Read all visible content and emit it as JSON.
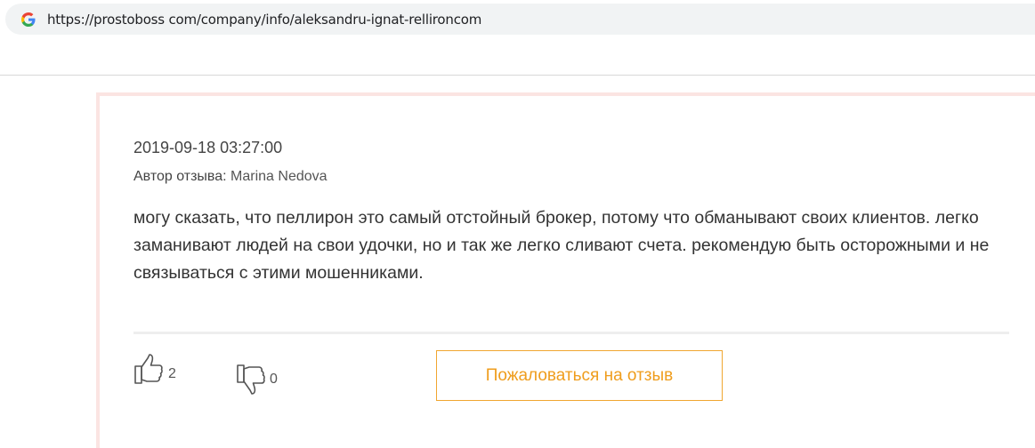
{
  "browser": {
    "url": "https://prostoboss com/company/info/aleksandru-ignat-rellironcom"
  },
  "review": {
    "date": "2019-09-18 03:27:00",
    "author_label": "Автор отзыва:",
    "author_name": "Marina Nedova",
    "text": "могу сказать, что пеллирон это самый отстойный брокер, потому что обманывают своих клиентов. легко заманивают людей на свои удочки, но и так же легко сливают счета. рекомендую быть осторожными и не связываться с этими мошенниками.",
    "likes": "2",
    "dislikes": "0",
    "complain_label": "Пожаловаться на отзыв"
  },
  "colors": {
    "accent": "#f0a630",
    "card_border": "#fbe4e2"
  },
  "icons": {
    "browser": "google-g-icon",
    "like": "thumbs-up-icon",
    "dislike": "thumbs-down-icon"
  }
}
